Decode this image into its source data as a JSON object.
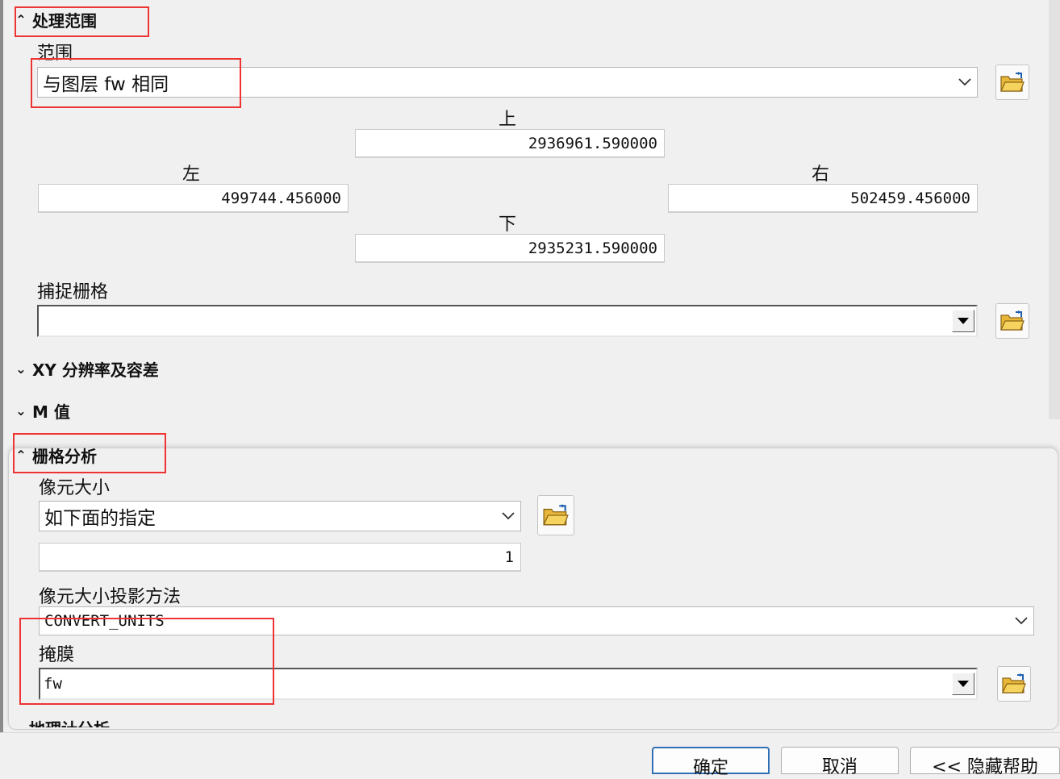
{
  "sections": {
    "processing_extent": "处理范围",
    "xy_resolution": "XY 分辨率及容差",
    "m_values": "M 值",
    "raster_analysis": "栅格分析",
    "next_section_partial": "地理计分析"
  },
  "extent": {
    "label": "范围",
    "value": "与图层 fw 相同",
    "top_label": "上",
    "top_value": "2936961.590000",
    "left_label": "左",
    "left_value": "499744.456000",
    "right_label": "右",
    "right_value": "502459.456000",
    "bottom_label": "下",
    "bottom_value": "2935231.590000"
  },
  "snap_raster": {
    "label": "捕捉栅格",
    "value": ""
  },
  "raster": {
    "cell_size_label": "像元大小",
    "cell_size_option": "如下面的指定",
    "cell_size_value": "1",
    "projection_label": "像元大小投影方法",
    "projection_value": "CONVERT_UNITS",
    "mask_label": "掩膜",
    "mask_value": "fw"
  },
  "buttons": {
    "ok": "确定",
    "cancel": "取消",
    "hide_help": "<< 隐藏帮助"
  },
  "icons": {
    "folder": "folder-open-icon",
    "chevron_up": "chevron-up-icon",
    "chevron_down": "chevron-down-icon"
  },
  "colors": {
    "highlight_box": "#e33333",
    "accent_border": "#2f6fb5"
  }
}
